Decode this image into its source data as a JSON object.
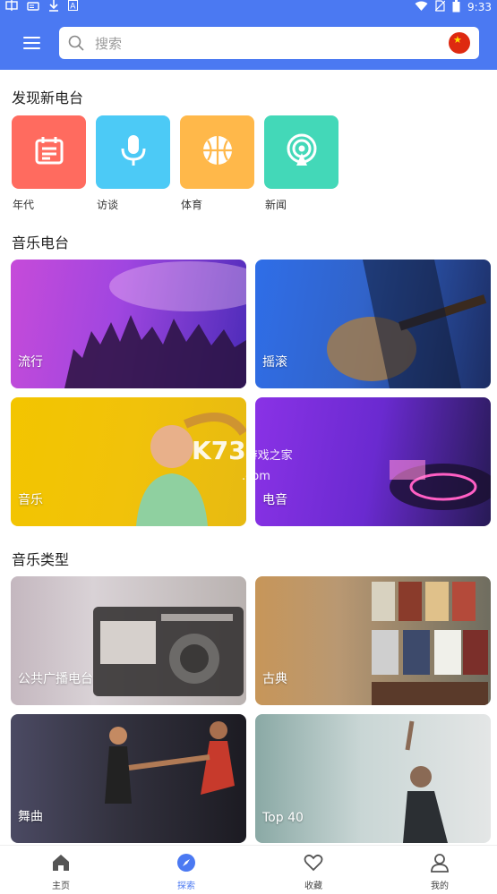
{
  "status_bar": {
    "left_icons": [
      "signal-icon",
      "radio-icon",
      "download-icon",
      "a-icon"
    ],
    "time": "9:33"
  },
  "search": {
    "placeholder": "搜索"
  },
  "discover": {
    "title": "发现新电台",
    "items": [
      {
        "label": "年代",
        "color": "#ff6b5f",
        "icon": "calendar-icon"
      },
      {
        "label": "访谈",
        "color": "#4ccaf6",
        "icon": "microphone-icon"
      },
      {
        "label": "体育",
        "color": "#ffb84a",
        "icon": "basketball-icon"
      },
      {
        "label": "新闻",
        "color": "#43d8b8",
        "icon": "broadcast-icon"
      }
    ]
  },
  "music_radio": {
    "title": "音乐电台",
    "cards": [
      {
        "label": "流行"
      },
      {
        "label": "摇滚"
      },
      {
        "label": "音乐"
      },
      {
        "label": "电音"
      }
    ]
  },
  "watermark": {
    "main": "K73",
    "sub": "游戏之家",
    "domain": ".com"
  },
  "music_genres": {
    "title": "音乐类型",
    "cards": [
      {
        "label": "公共广播电台"
      },
      {
        "label": "古典"
      },
      {
        "label": "舞曲"
      },
      {
        "label": "Top 40"
      }
    ]
  },
  "tabbar": {
    "accent": "#4b79f2",
    "tabs": [
      {
        "label": "主页",
        "icon": "home-icon"
      },
      {
        "label": "探索",
        "icon": "compass-icon",
        "active": true
      },
      {
        "label": "收藏",
        "icon": "heart-icon"
      },
      {
        "label": "我的",
        "icon": "user-icon"
      }
    ]
  }
}
